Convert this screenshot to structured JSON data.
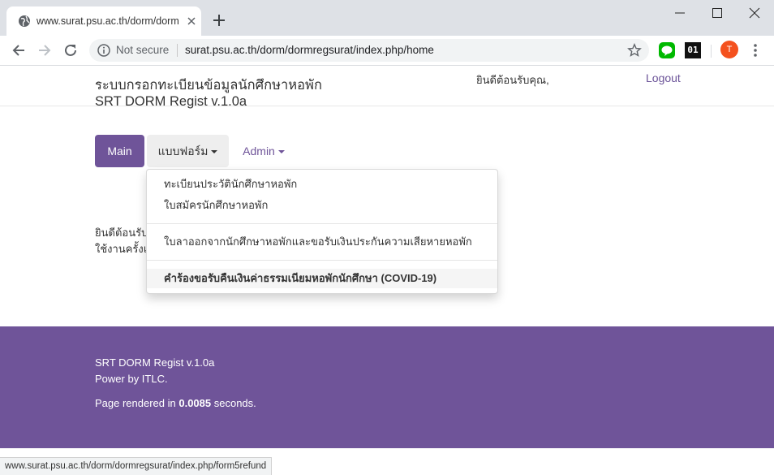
{
  "browser": {
    "tab_title": "www.surat.psu.ac.th/dorm/dormregsurat/index.php/home",
    "security_label": "Not secure",
    "url": "surat.psu.ac.th/dorm/dormregsurat/index.php/home",
    "ext_01_label": "01",
    "avatar_letter": "T",
    "status_url": "www.surat.psu.ac.th/dorm/dormregsurat/index.php/form5refund"
  },
  "header": {
    "title_line1": "ระบบกรอกทะเบียนข้อมูลนักศึกษาหอพัก",
    "title_line2": "SRT DORM Regist v.1.0a",
    "welcome": "ยินดีต้อนรับคุณ,",
    "logout": "Logout"
  },
  "nav": {
    "main": "Main",
    "forms": "แบบฟอร์ม",
    "admin": "Admin"
  },
  "dropdown": {
    "items": [
      "ทะเบียนประวัตินักศึกษาหอพัก",
      "ใบสมัครนักศึกษาหอพัก",
      "ใบลาออกจากนักศึกษาหอพักและขอรับเงินประกันความเสียหายหอพัก",
      "คำร้องขอรับคืนเงินค่าธรรมเนียมหอพักนักศึกษา (COVID-19)"
    ]
  },
  "body": {
    "line1": "ยินดีต้อนรับ",
    "line2": "ใช้งานครั้งแ"
  },
  "footer": {
    "line1": "SRT DORM Regist v.1.0a",
    "line2": "Power by ITLC.",
    "rendered_prefix": "Page rendered in ",
    "rendered_value": "0.0085",
    "rendered_suffix": " seconds."
  },
  "colors": {
    "brand_purple": "#6f5499",
    "chrome_tabbar": "#dee1e6"
  }
}
